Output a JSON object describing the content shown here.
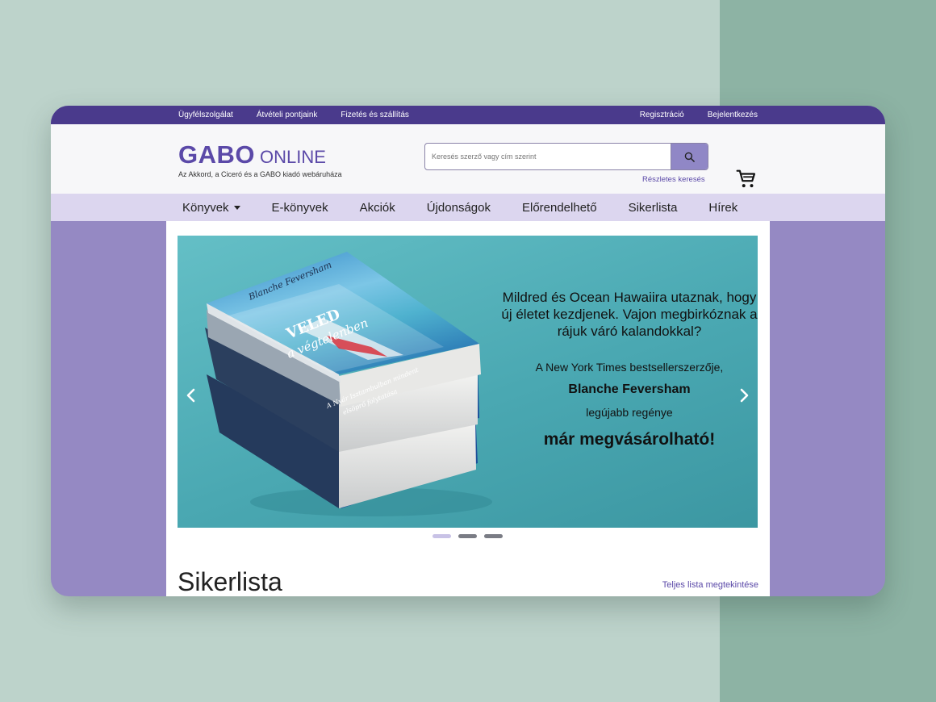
{
  "topbar": {
    "left_links": [
      "Ügyfélszolgálat",
      "Átvételi pontjaink",
      "Fizetés és szállítás"
    ],
    "right_links": [
      "Regisztráció",
      "Bejelentkezés"
    ]
  },
  "header": {
    "brand_main": "GABO",
    "brand_sub": "ONLINE",
    "tagline": "Az Akkord, a Ciceró és a GABO kiadó webáruháza",
    "search_placeholder": "Keresés szerző vagy cím szerint",
    "advanced_search": "Részletes keresés"
  },
  "nav": {
    "items": [
      "Könyvek",
      "E-könyvek",
      "Akciók",
      "Újdonságok",
      "Előrendelhető",
      "Sikerlista",
      "Hírek"
    ]
  },
  "banner": {
    "book_author": "Blanche Feversham",
    "book_title_1": "VELED",
    "book_title_2": "a végtelenben",
    "book_subtitle_1": "A Nyár Isztambulban mindent",
    "book_subtitle_2": "elsöprő folytatása",
    "lead": "Mildred és Ocean Hawaiira utaznak, hogy új életet kezdjenek. Vajon megbirkóznak a rájuk váró kalandokkal?",
    "line2": "A New York Times bestsellerszerzője,",
    "author": "Blanche Feversham",
    "line3": "legújabb regénye",
    "cta": "már megvásárolható!",
    "slides": 3,
    "active_slide": 1
  },
  "section": {
    "title": "Sikerlista",
    "link": "Teljes lista megtekintése"
  },
  "colors": {
    "brand": "#5b49a8",
    "topbar": "#4a3a8c",
    "nav": "#dcd6ef",
    "page": "#9589c3",
    "banner": "#4aa8b2"
  }
}
